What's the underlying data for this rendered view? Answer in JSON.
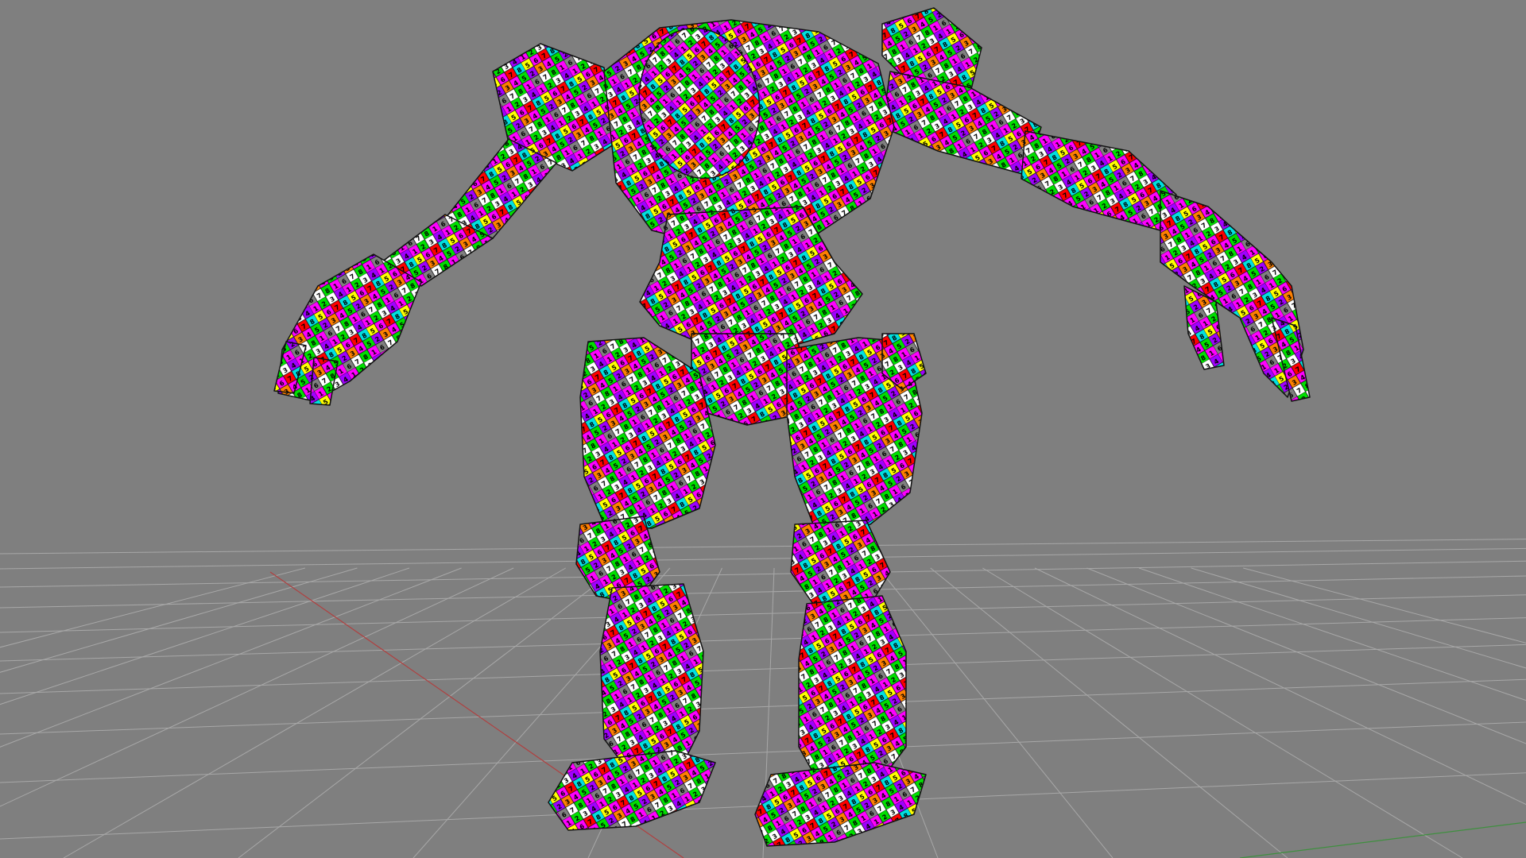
{
  "viewport": {
    "background_color": "#7f7f7f",
    "grid_color": "#a8a8a8",
    "x_axis_color": "#b04040",
    "z_axis_color": "#3f8f3f",
    "wire_color": "#111111"
  },
  "model": {
    "uv_checker_colors": [
      "#ff00ff",
      "#a000ff",
      "#00e000",
      "#ffff00",
      "#ff8000",
      "#ff0000",
      "#00e0e0",
      "#ffffff",
      "#808080"
    ],
    "uv_checker_digits": [
      "1",
      "2",
      "3",
      "4",
      "5",
      "6",
      "7",
      "8"
    ]
  }
}
